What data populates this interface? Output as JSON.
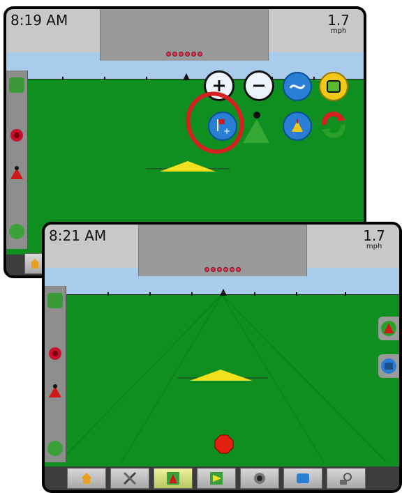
{
  "screen_top": {
    "time": "8:19 AM",
    "speed_value": "1.7",
    "speed_unit": "mph"
  },
  "screen_bottom": {
    "time": "8:21 AM",
    "speed_value": "1.7",
    "speed_unit": "mph"
  },
  "colors": {
    "field": "#0f8f1f",
    "sky": "#a9ccec",
    "highlight_ring": "#d42020"
  },
  "tools": [
    "zoom-in-icon",
    "zoom-out-icon",
    "guidance-mode-icon",
    "boundary-icon",
    "add-mark-point-icon",
    "vehicle-view-icon",
    "bird-eye-view-icon",
    "refresh-icon"
  ],
  "nav": [
    "home-icon",
    "tools-icon",
    "vehicle-view-icon",
    "map-view-icon",
    "gps-icon",
    "data-icon",
    "lock-icon"
  ]
}
